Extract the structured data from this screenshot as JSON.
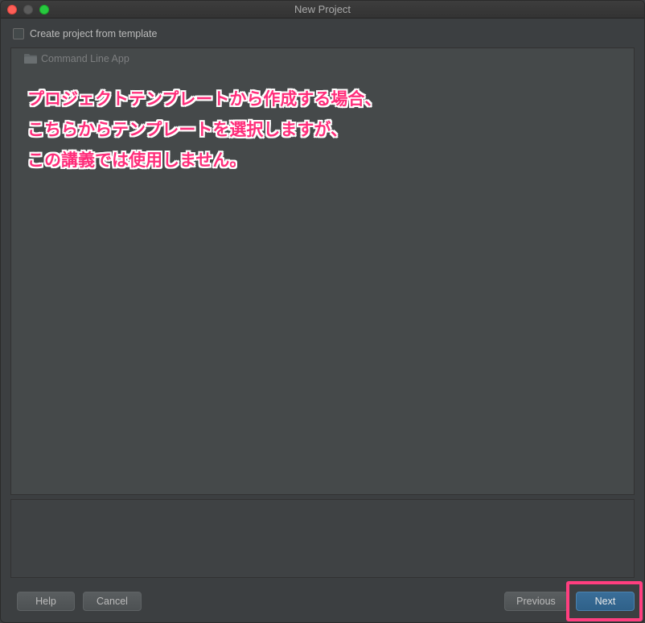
{
  "window": {
    "title": "New Project"
  },
  "template_option": {
    "label": "Create project from template",
    "checked": false
  },
  "template_list": {
    "items": [
      {
        "label": "Command Line App",
        "icon": "folder-icon"
      }
    ]
  },
  "annotation": {
    "lines": [
      "プロジェクトテンプレートから作成する場合、",
      "こちらからテンプレートを選択しますが、",
      "この講義では使用しません。"
    ],
    "color": "#ff2d7a"
  },
  "buttons": {
    "help": "Help",
    "cancel": "Cancel",
    "previous": "Previous",
    "next": "Next"
  },
  "highlight": {
    "target": "next-button",
    "color": "#ff3e7f"
  },
  "colors": {
    "background": "#3c3f41",
    "primary_button": "#2f6189",
    "close_dot": "#fe5f57",
    "maximize_dot": "#27c93f"
  }
}
